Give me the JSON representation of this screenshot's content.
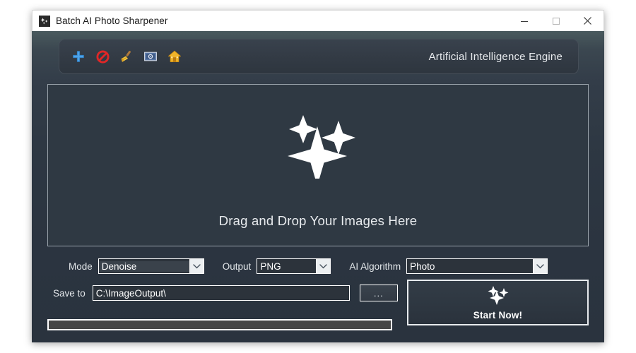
{
  "window": {
    "title": "Batch AI Photo Sharpener",
    "app_icon": "sparkle-app-icon",
    "controls": [
      {
        "name": "minimize",
        "label": "–"
      },
      {
        "name": "maximize",
        "label": "☐"
      },
      {
        "name": "close",
        "label": "✕"
      }
    ]
  },
  "toolbar": {
    "engine_label": "Artificial Intelligence Engine",
    "icons": [
      {
        "name": "add-icon",
        "title": "Add"
      },
      {
        "name": "remove-icon",
        "title": "Remove"
      },
      {
        "name": "clear-icon",
        "title": "Clear"
      },
      {
        "name": "preview-icon",
        "title": "Preview"
      },
      {
        "name": "home-icon",
        "title": "Home"
      }
    ]
  },
  "drop_area": {
    "icon": "sparkles-icon",
    "text": "Drag and Drop Your Images Here"
  },
  "options": {
    "mode": {
      "label": "Mode",
      "value": "Denoise",
      "selected": true
    },
    "output": {
      "label": "Output",
      "value": "PNG"
    },
    "ai_algorithm": {
      "label": "AI Algorithm",
      "value": "Photo"
    }
  },
  "save": {
    "label": "Save to",
    "path": "C:\\ImageOutput\\",
    "browse_label": "..."
  },
  "start": {
    "label": "Start Now!",
    "icon": "sparkles-icon"
  },
  "progress": {
    "value": 0,
    "value_text": "0%"
  },
  "colors": {
    "window_background": "#2b3540",
    "panel_background": "#333b45",
    "drop_background": "#2f3943",
    "accent_text": "#ffffff",
    "title_bar": "#ffffff",
    "progress_track": "#464646"
  }
}
